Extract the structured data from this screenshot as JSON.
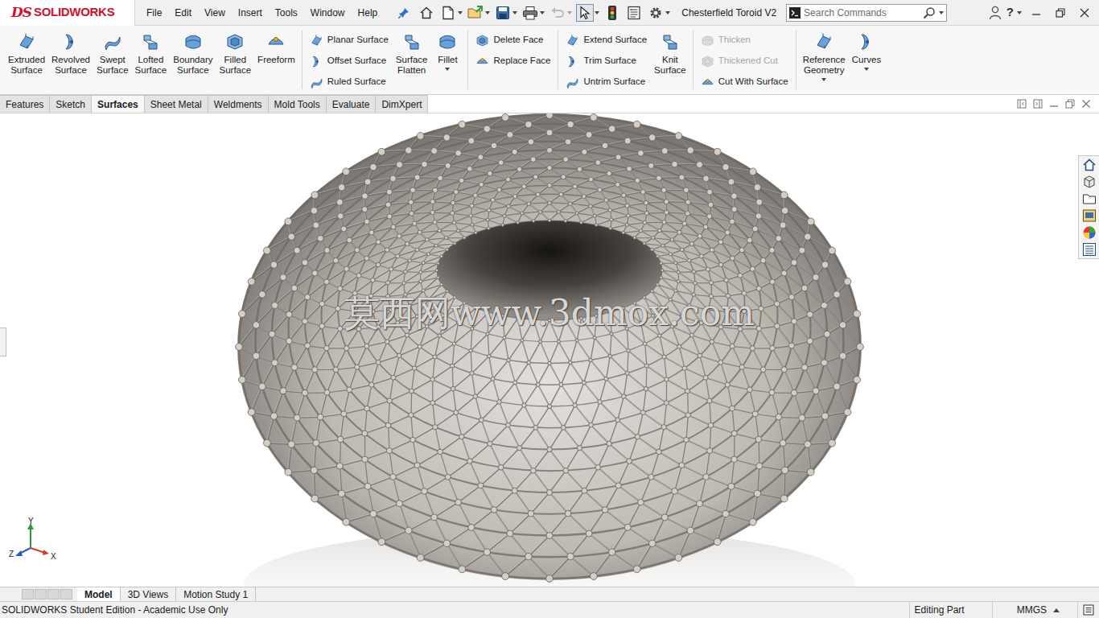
{
  "app": {
    "logo_mark": "DS",
    "logo": "SOLIDWORKS"
  },
  "menu": [
    "File",
    "Edit",
    "View",
    "Insert",
    "Tools",
    "Window",
    "Help"
  ],
  "quick_access": [
    {
      "disabled": false,
      "selected": false
    },
    {
      "disabled": false,
      "selected": false
    },
    {
      "disabled": false,
      "selected": false
    },
    {
      "disabled": false,
      "selected": false
    },
    {
      "disabled": false,
      "selected": false
    },
    {
      "disabled": true,
      "selected": false
    },
    {
      "disabled": false,
      "selected": true
    },
    {
      "disabled": false,
      "selected": false
    },
    {
      "disabled": false,
      "selected": false
    },
    {
      "disabled": false,
      "selected": false
    }
  ],
  "document_title": "Chesterfield Toroid V2",
  "search": {
    "placeholder": "Search Commands"
  },
  "help": {
    "label": "?"
  },
  "ribbon": {
    "sections": [
      {
        "items": [
          {
            "kind": "large",
            "label": "Extruded Surface",
            "disabled": false,
            "dropdown": false
          },
          {
            "kind": "large",
            "label": "Revolved Surface",
            "disabled": false,
            "dropdown": false
          },
          {
            "kind": "large",
            "label": "Swept Surface",
            "disabled": false,
            "dropdown": false
          },
          {
            "kind": "large",
            "label": "Lofted Surface",
            "disabled": false,
            "dropdown": false
          },
          {
            "kind": "large",
            "label": "Boundary Surface",
            "disabled": false,
            "dropdown": false
          },
          {
            "kind": "large",
            "label": "Filled Surface",
            "disabled": false,
            "dropdown": false
          },
          {
            "kind": "large",
            "label": "Freeform",
            "disabled": false,
            "dropdown": false
          }
        ]
      },
      {
        "items": [
          {
            "kind": "stack",
            "buttons": [
              {
                "label": "Planar Surface",
                "disabled": false
              },
              {
                "label": "Offset Surface",
                "disabled": false
              },
              {
                "label": "Ruled Surface",
                "disabled": false
              }
            ]
          },
          {
            "kind": "large",
            "label": "Surface Flatten",
            "disabled": false,
            "dropdown": false
          },
          {
            "kind": "large",
            "label": "Fillet",
            "disabled": false,
            "dropdown": true
          }
        ]
      },
      {
        "items": [
          {
            "kind": "stack",
            "buttons": [
              {
                "label": "Delete Face",
                "disabled": false
              },
              {
                "label": "Replace Face",
                "disabled": false
              }
            ]
          }
        ]
      },
      {
        "items": [
          {
            "kind": "stack",
            "buttons": [
              {
                "label": "Extend Surface",
                "disabled": false
              },
              {
                "label": "Trim Surface",
                "disabled": false
              },
              {
                "label": "Untrim Surface",
                "disabled": false
              }
            ]
          },
          {
            "kind": "large",
            "label": "Knit Surface",
            "disabled": false,
            "dropdown": false
          }
        ]
      },
      {
        "items": [
          {
            "kind": "stack",
            "buttons": [
              {
                "label": "Thicken",
                "disabled": true
              },
              {
                "label": "Thickened Cut",
                "disabled": true
              },
              {
                "label": "Cut With Surface",
                "disabled": false
              }
            ]
          }
        ]
      },
      {
        "items": [
          {
            "kind": "large",
            "label": "Reference Geometry",
            "disabled": false,
            "dropdown": true
          },
          {
            "kind": "large",
            "label": "Curves",
            "disabled": false,
            "dropdown": true
          }
        ]
      }
    ]
  },
  "command_tabs": [
    {
      "label": "Features",
      "selected": false
    },
    {
      "label": "Sketch",
      "selected": false
    },
    {
      "label": "Surfaces",
      "selected": true
    },
    {
      "label": "Sheet Metal",
      "selected": false
    },
    {
      "label": "Weldments",
      "selected": false
    },
    {
      "label": "Mold Tools",
      "selected": false
    },
    {
      "label": "Evaluate",
      "selected": false
    },
    {
      "label": "DimXpert",
      "selected": false
    }
  ],
  "viewport": {
    "watermark": "莫西网www.3dmox.com",
    "triad": {
      "x": "X",
      "y": "Y",
      "z": "Z"
    }
  },
  "model_tabs": [
    {
      "label": "Model",
      "selected": true
    },
    {
      "label": "3D Views",
      "selected": false
    },
    {
      "label": "Motion Study 1",
      "selected": false
    }
  ],
  "status_bar": {
    "edition": "SOLIDWORKS Student Edition - Academic Use Only",
    "mode": "Editing Part",
    "units": "MMGS"
  }
}
